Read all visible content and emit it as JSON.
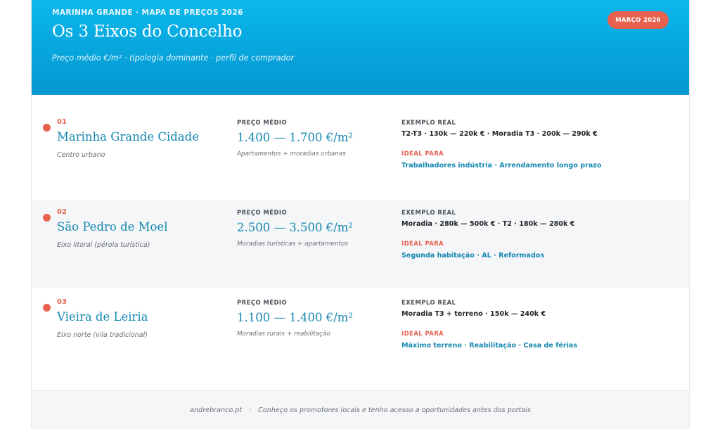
{
  "header": {
    "eyebrow": "MARINHA GRANDE · MAPA DE PREÇOS 2026",
    "title": "Os 3 Eixos do Concelho",
    "subtitle": "Preço médio €/m² · tipologia dominante · perfil de comprador",
    "badge": "MARÇO 2026"
  },
  "labels": {
    "price": "PREÇO MÉDIO",
    "example": "EXEMPLO REAL",
    "ideal": "IDEAL PARA"
  },
  "rows": [
    {
      "number": "01",
      "name": "Marinha Grande Cidade",
      "description": "Centro urbano",
      "price": "1.400 — 1.700 €/m²",
      "price_description": "Apartamentos + moradias urbanas",
      "example": "T2-T3 · 130k — 220k €  ·  Moradia T3 · 200k — 290k €",
      "ideal": "Trabalhadores indústria · Arrendamento longo prazo"
    },
    {
      "number": "02",
      "name": "São Pedro de Moel",
      "description": "Eixo litoral (pérola turística)",
      "price": "2.500 — 3.500 €/m²",
      "price_description": "Moradias turísticas + apartamentos",
      "example": "Moradia · 280k — 500k €  ·  T2 · 180k — 280k €",
      "ideal": "Segunda habitação · AL · Reformados"
    },
    {
      "number": "03",
      "name": "Vieira de Leiria",
      "description": "Eixo norte (vila tradicional)",
      "price": "1.100 — 1.400 €/m²",
      "price_description": "Moradias rurais + reabilitação",
      "example": "Moradia T3 + terreno · 150k — 240k €",
      "ideal": "Máximo terreno · Reabilitação · Casa de férias"
    }
  ],
  "footer": {
    "site": "andrebranco.pt",
    "separator": "·",
    "tagline": "Conheço os promotores locais e tenho acesso a oportunidades antes dos portais"
  },
  "colors": {
    "header_top": "#0ab8ec",
    "header_bottom": "#0596d0",
    "accent": "#e8604e",
    "link": "#1487b0"
  }
}
